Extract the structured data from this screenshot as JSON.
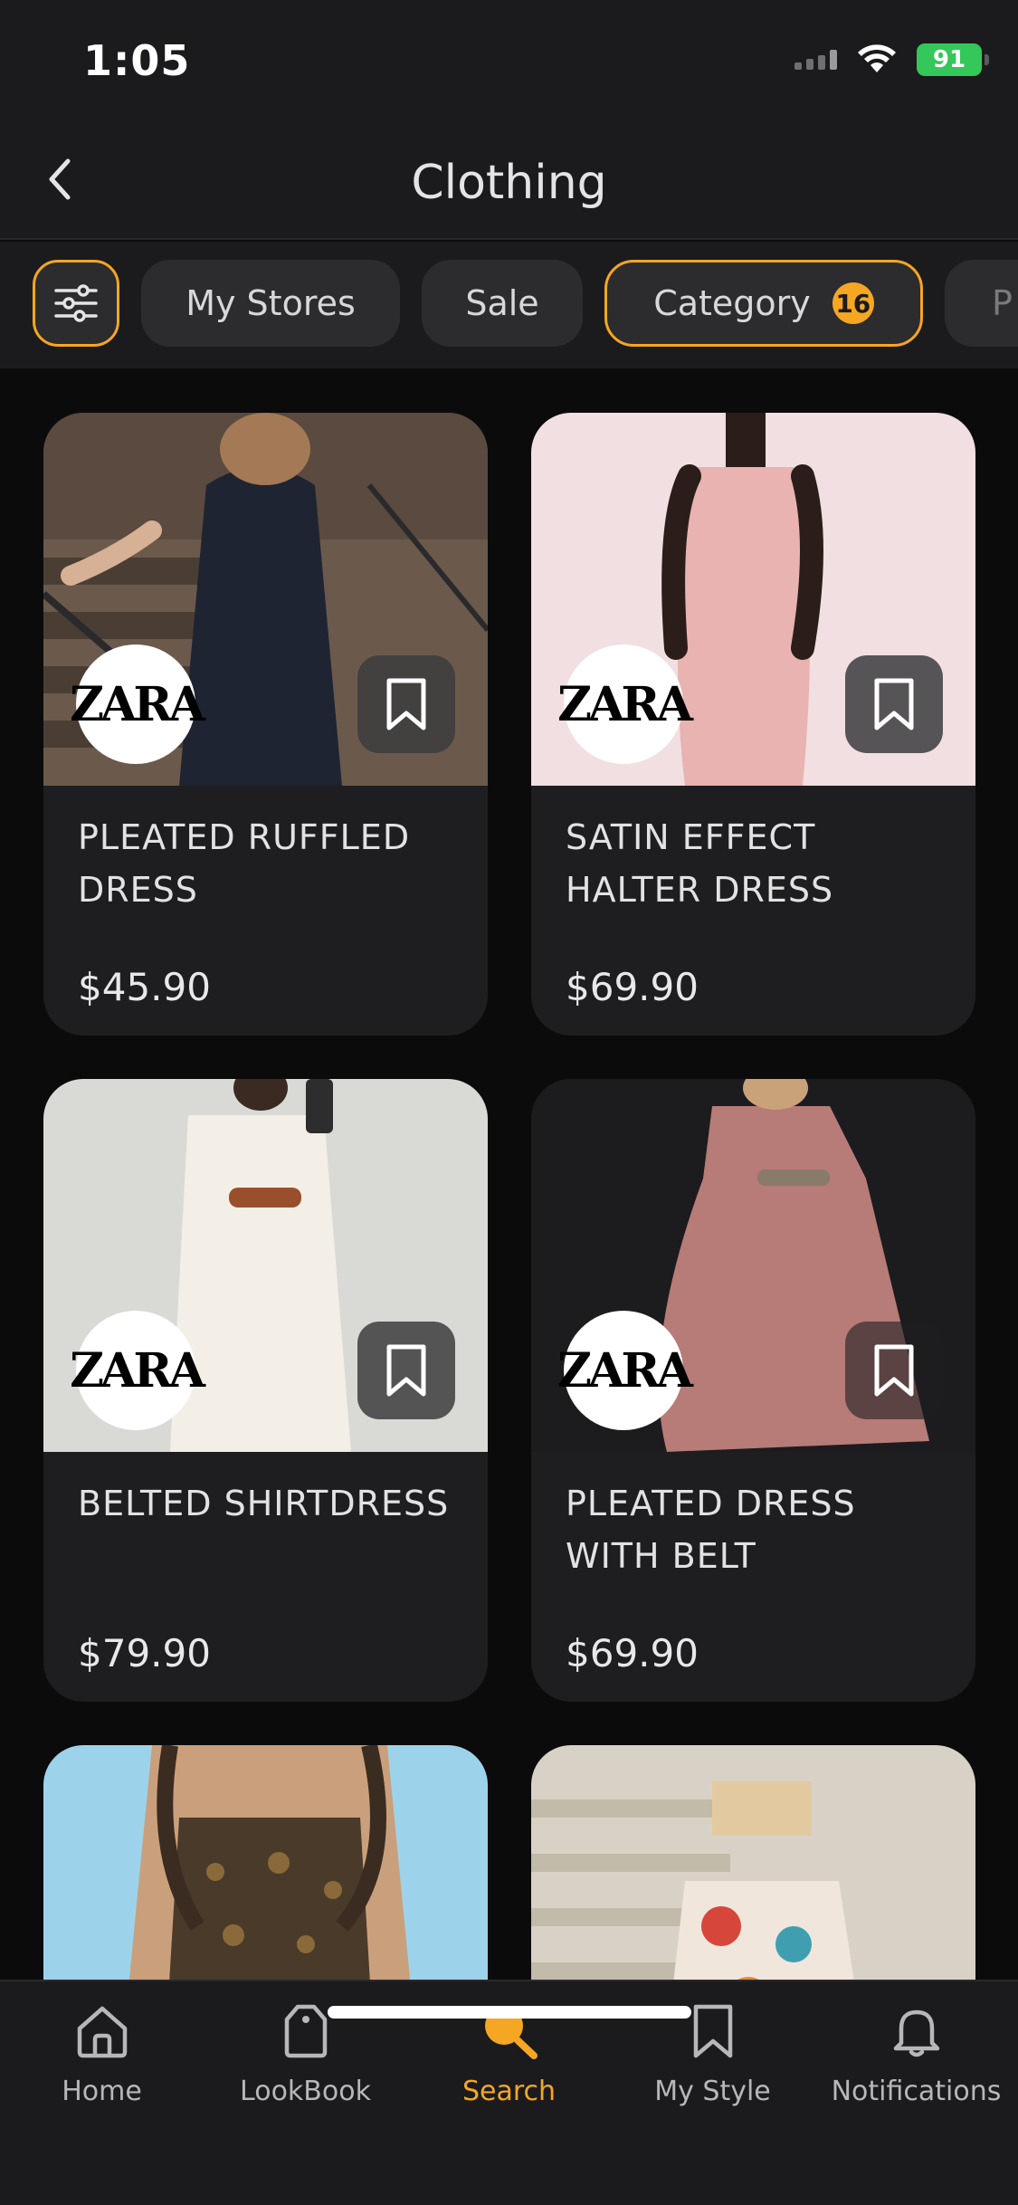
{
  "status_bar": {
    "time": "1:05",
    "battery": "91"
  },
  "header": {
    "title": "Clothing"
  },
  "filters": {
    "chips": [
      {
        "label": "My Stores"
      },
      {
        "label": "Sale"
      },
      {
        "label": "Category",
        "badge": "16"
      },
      {
        "label": "P"
      }
    ]
  },
  "products": [
    {
      "brand": "ZARA",
      "name": "PLEATED RUFFLED DRESS",
      "price": "$45.90"
    },
    {
      "brand": "ZARA",
      "name": "SATIN EFFECT HALTER DRESS",
      "price": "$69.90"
    },
    {
      "brand": "ZARA",
      "name": "BELTED SHIRTDRESS",
      "price": "$79.90"
    },
    {
      "brand": "ZARA",
      "name": "PLEATED DRESS WITH BELT",
      "price": "$69.90"
    }
  ],
  "tabs": [
    {
      "label": "Home",
      "icon": "home-icon"
    },
    {
      "label": "LookBook",
      "icon": "tag-icon"
    },
    {
      "label": "Search",
      "icon": "search-icon",
      "active": true
    },
    {
      "label": "My Style",
      "icon": "bookmark-icon"
    },
    {
      "label": "Notifications",
      "icon": "bell-icon"
    }
  ],
  "colors": {
    "accent": "#f5a623",
    "background": "#0b0b0c",
    "surface": "#1e1e20"
  }
}
